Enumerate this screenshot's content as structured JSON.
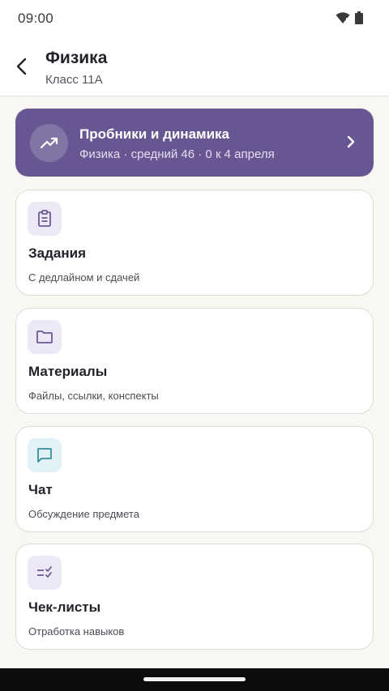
{
  "status": {
    "time": "09:00"
  },
  "header": {
    "title": "Физика",
    "subtitle": "Класс 11А"
  },
  "banner": {
    "title": "Пробники и динамика",
    "subtitle": "Физика · средний 46 · 0 к 4 апреля",
    "icon": "trending-up-icon"
  },
  "cards": [
    {
      "title": "Задания",
      "subtitle": "С дедлайном и сдачей",
      "icon": "clipboard-icon",
      "icon_bg": "#ece8f5",
      "icon_color": "#6a5a96"
    },
    {
      "title": "Материалы",
      "subtitle": "Файлы, ссылки, конспекты",
      "icon": "folder-icon",
      "icon_bg": "#ece8f5",
      "icon_color": "#6a5a96"
    },
    {
      "title": "Чат",
      "subtitle": "Обсуждение предмета",
      "icon": "chat-icon",
      "icon_bg": "#e1f2f6",
      "icon_color": "#3a8ba0"
    },
    {
      "title": "Чек-листы",
      "subtitle": "Отработка навыков",
      "icon": "checklist-icon",
      "icon_bg": "#ece8f5",
      "icon_color": "#6a5a96"
    }
  ],
  "colors": {
    "accent": "#675692",
    "background": "#f8f7f2"
  }
}
